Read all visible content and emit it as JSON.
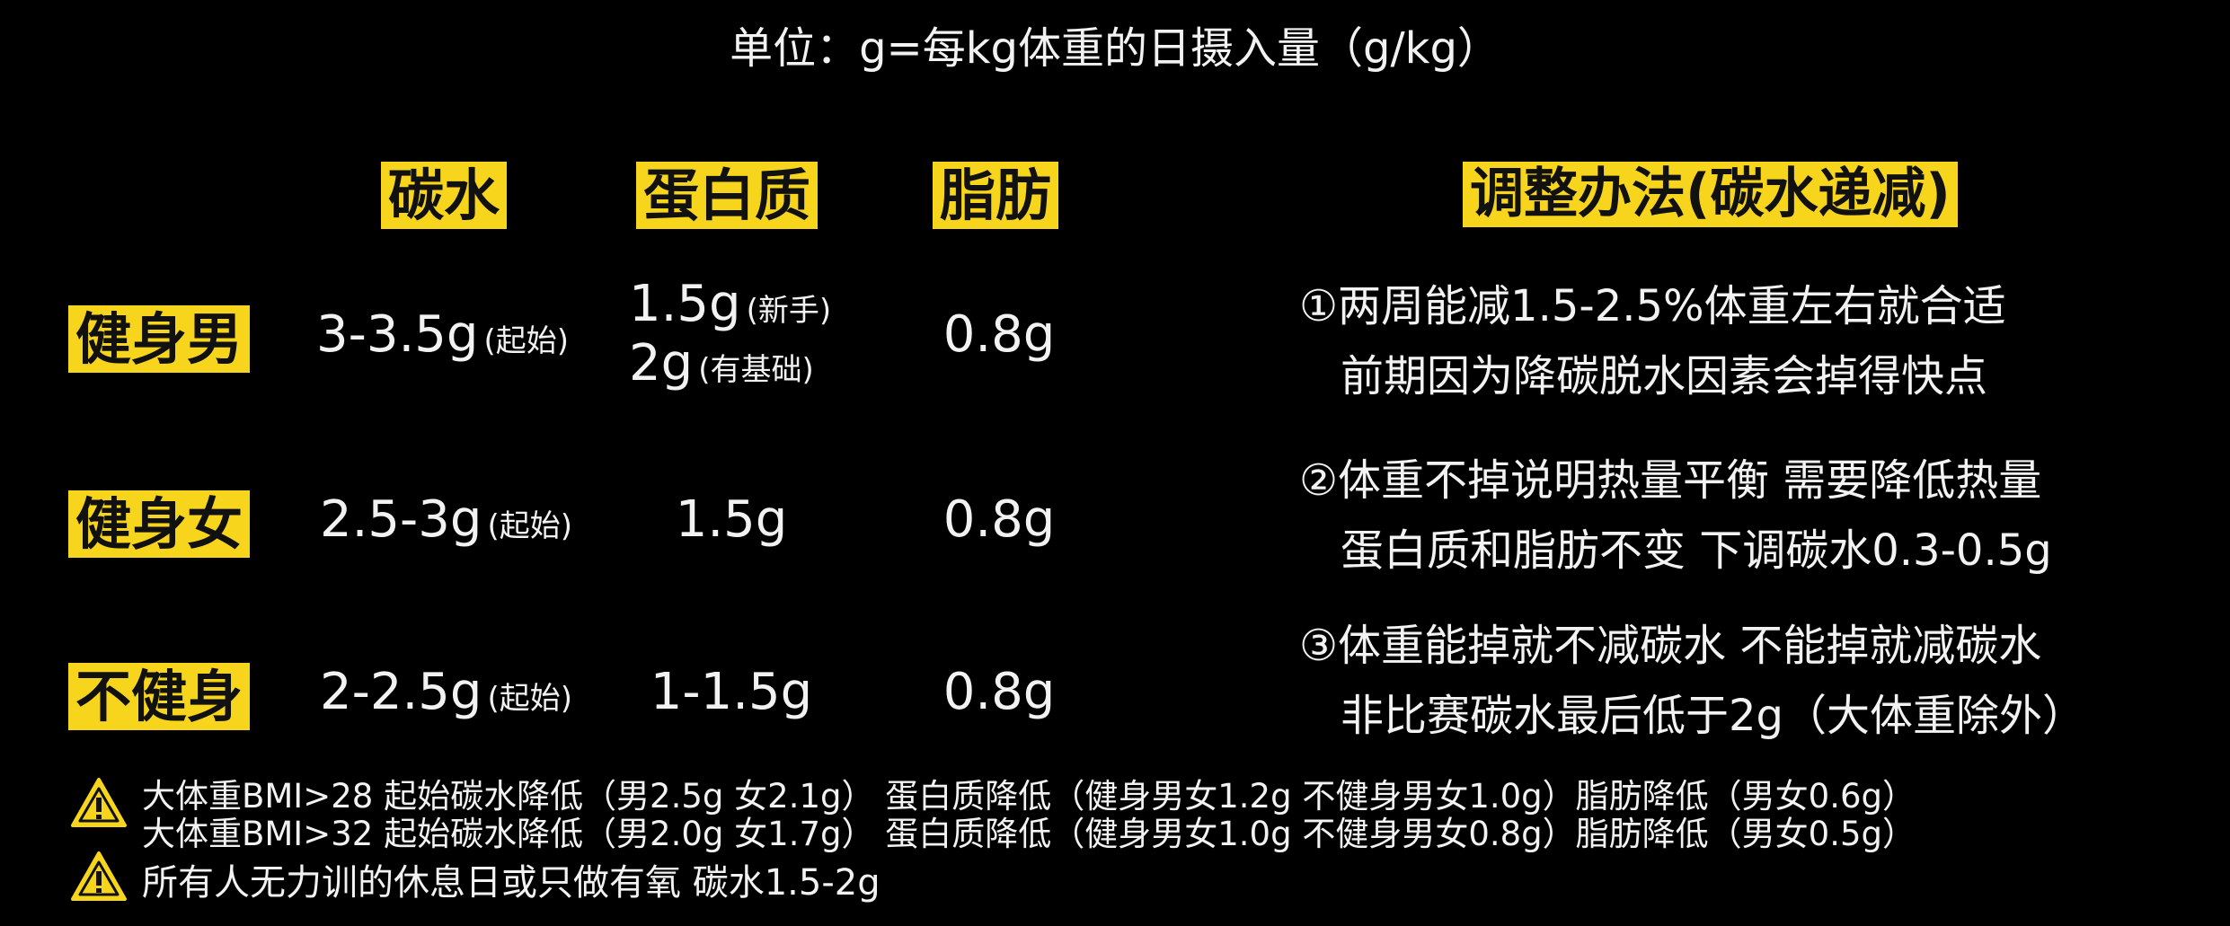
{
  "unit_line": "单位：g=每kg体重的日摄入量（g/kg）",
  "headers": {
    "carb": "碳水",
    "protein": "蛋白质",
    "fat": "脂肪",
    "adjust": "调整办法(碳水递减)"
  },
  "rows": [
    {
      "label": "健身男",
      "carb": "3-3.5g",
      "carb_note": "(起始)",
      "protein_1": "1.5g",
      "protein_1_note": "(新手)",
      "protein_2": "2g",
      "protein_2_note": "(有基础)",
      "fat": "0.8g"
    },
    {
      "label": "健身女",
      "carb": "2.5-3g",
      "carb_note": "(起始)",
      "protein": "1.5g",
      "fat": "0.8g"
    },
    {
      "label": "不健身",
      "carb": "2-2.5g",
      "carb_note": "(起始)",
      "protein": "1-1.5g",
      "fat": "0.8g"
    }
  ],
  "adjustments": [
    {
      "line1": "①两周能减1.5-2.5%体重左右就合适",
      "line2": "前期因为降碳脱水因素会掉得快点"
    },
    {
      "line1": "②体重不掉说明热量平衡 需要降低热量",
      "line2": "蛋白质和脂肪不变 下调碳水0.3-0.5g"
    },
    {
      "line1": "③体重能掉就不减碳水 不能掉就减碳水",
      "line2": "非比赛碳水最后低于2g（大体重除外）"
    }
  ],
  "warnings": {
    "bmi_28": "大体重BMI>28 起始碳水降低（男2.5g 女2.1g） 蛋白质降低（健身男女1.2g 不健身男女1.0g）脂肪降低（男女0.6g）",
    "bmi_32": "大体重BMI>32 起始碳水降低（男2.0g 女1.7g） 蛋白质降低（健身男女1.0g 不健身男女0.8g）脂肪降低（男女0.5g）",
    "rest_day": "所有人无力训的休息日或只做有氧 碳水1.5-2g"
  },
  "colors": {
    "highlight": "#f7d51d",
    "background": "#000000",
    "text": "#f2f2f2"
  },
  "icons": [
    "warning-icon"
  ]
}
